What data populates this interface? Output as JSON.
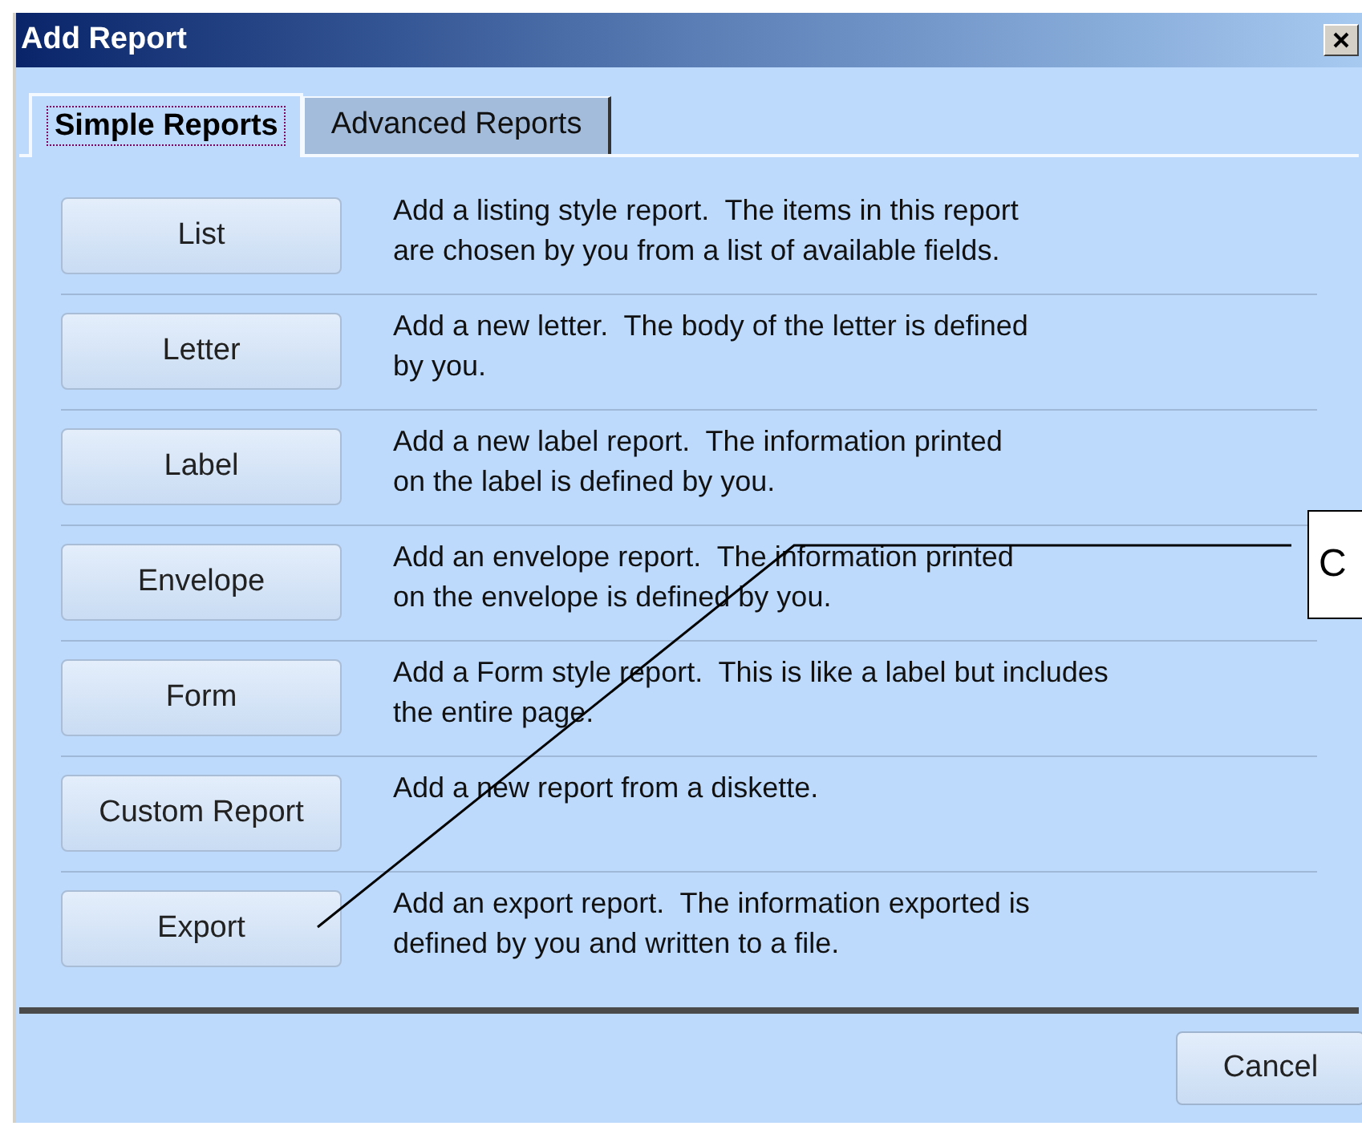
{
  "window": {
    "title": "Add Report"
  },
  "tabs": [
    {
      "label": "Simple Reports",
      "selected": true
    },
    {
      "label": "Advanced Reports",
      "selected": false
    }
  ],
  "reports": [
    {
      "button": "List",
      "description": "Add a listing style report.  The items in this report\nare chosen by you from a list of available fields."
    },
    {
      "button": "Letter",
      "description": "Add a new letter.  The body of the letter is defined\nby you."
    },
    {
      "button": "Label",
      "description": "Add a new label report.  The information printed\non the label is defined by you."
    },
    {
      "button": "Envelope",
      "description": "Add an envelope report.  The information printed\non the envelope is defined by you."
    },
    {
      "button": "Form",
      "description": "Add a Form style report.  This is like a label but includes\nthe entire page."
    },
    {
      "button": "Custom Report",
      "description": "Add a new report from a diskette."
    },
    {
      "button": "Export",
      "description": "Add an export report.  The information exported is\ndefined by you and written to a file."
    }
  ],
  "footer_buttons": [
    "Cancel"
  ],
  "callout": {
    "text": "C"
  }
}
